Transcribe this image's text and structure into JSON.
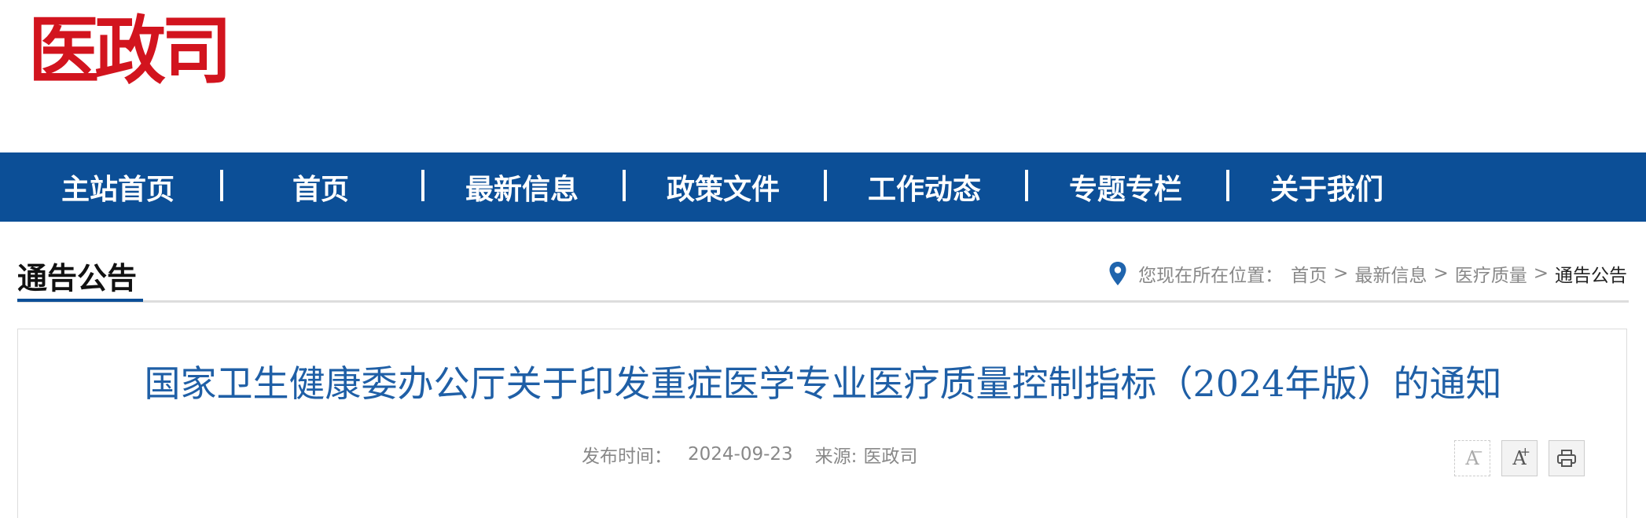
{
  "site": {
    "logo_text": "医政司"
  },
  "nav": {
    "items": [
      {
        "label": "主站首页"
      },
      {
        "label": "首页"
      },
      {
        "label": "最新信息"
      },
      {
        "label": "政策文件"
      },
      {
        "label": "工作动态"
      },
      {
        "label": "专题专栏"
      },
      {
        "label": "关于我们"
      }
    ],
    "separator": "|"
  },
  "section": {
    "title": "通告公告"
  },
  "breadcrumb": {
    "prefix": "您现在所在位置：",
    "items": [
      "首页",
      "最新信息",
      "医疗质量",
      "通告公告"
    ],
    "separator": ">"
  },
  "article": {
    "title": "国家卫生健康委办公厅关于印发重症医学专业医疗质量控制指标（2024年版）的通知",
    "publish_label": "发布时间：",
    "publish_date": "2024-09-23",
    "source_label": "来源:",
    "source": "医政司"
  },
  "tools": {
    "decrease_font": "A",
    "increase_font": "A",
    "print_icon": "printer-icon"
  },
  "colors": {
    "brand_red": "#d2141e",
    "nav_blue": "#0c4f97",
    "title_blue": "#1f5fa6"
  }
}
